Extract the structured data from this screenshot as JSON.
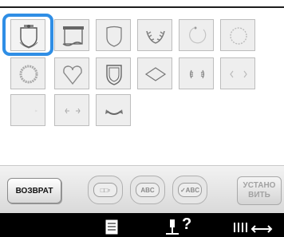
{
  "pattern_grid": {
    "rows": [
      [
        {
          "name": "frame-shield-crest-icon",
          "selected": true
        },
        {
          "name": "frame-scroll-banner-icon"
        },
        {
          "name": "frame-shield-plain-icon"
        },
        {
          "name": "frame-laurel-wreath-icon"
        },
        {
          "name": "frame-partial-circle-icon"
        },
        {
          "name": "frame-dotted-circle-icon"
        }
      ],
      [
        {
          "name": "frame-round-wreath-icon"
        },
        {
          "name": "frame-heart-icon"
        },
        {
          "name": "frame-double-shield-icon"
        },
        {
          "name": "frame-diamond-icon"
        },
        {
          "name": "frame-laurel-pair-icon"
        },
        {
          "name": "frame-brackets-icon"
        }
      ],
      [
        {
          "name": "frame-faint-corners-icon"
        },
        {
          "name": "frame-small-sprigs-icon"
        },
        {
          "name": "frame-ribbon-icon"
        }
      ]
    ]
  },
  "toolbar": {
    "return_label": "ВОЗВРАТ",
    "mode_buttons": [
      {
        "name": "shapes-icon",
        "label": "□□▫"
      },
      {
        "name": "arc-text-icon",
        "label": "ABC"
      },
      {
        "name": "check-abc-icon",
        "label": "✓ABC"
      }
    ],
    "set_label_line1": "УСТАНО",
    "set_label_line2": "ВИТЬ"
  },
  "status_bar": {
    "help_symbol": "?"
  },
  "colors": {
    "selection": "#2f8ee5",
    "tile_bg": "#eeeeee",
    "status_bar": "#000000"
  }
}
